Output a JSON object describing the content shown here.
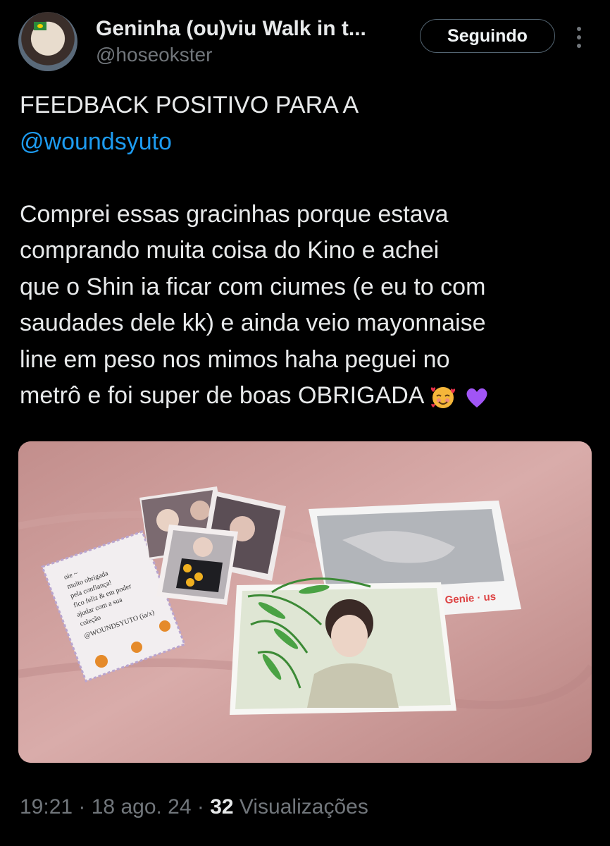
{
  "author": {
    "name": "Geninha (ou)viu Walk in t...",
    "handle": "@hoseokster"
  },
  "follow_button": {
    "label": "Seguindo"
  },
  "icons": {
    "more": "more-vertical-icon",
    "love_emoji": "smiling-face-with-hearts-emoji",
    "heart_emoji": "purple-heart-emoji"
  },
  "tweet": {
    "line1": "FEEDBACK POSITIVO PARA A",
    "mention": "@woundsyuto",
    "body_lines": [
      "Comprei essas gracinhas porque estava",
      "comprando muita coisa do Kino e achei",
      "que o Shin ia ficar com ciumes (e eu to com",
      "saudades dele kk) e ainda veio mayonnaise",
      "line em peso nos mimos haha peguei no",
      "metrô e foi super de boas OBRIGADA"
    ]
  },
  "media": {
    "note_lines": [
      "oie ~",
      "muito obrigada",
      "pela confiança!",
      "fico feliz & em poder",
      "ajudar com a sua",
      "coleção",
      "@WOUNDSYUTO (ia/x)"
    ],
    "brand": "Genie · us"
  },
  "meta": {
    "time": "19:21",
    "sep1": " · ",
    "date": "18 ago. 24",
    "sep2": " · ",
    "views_count": "32",
    "views_label": " Visualizações"
  },
  "colors": {
    "background": "#000000",
    "text": "#e7e9ea",
    "secondary": "#71767b",
    "link": "#1d9bf0"
  }
}
